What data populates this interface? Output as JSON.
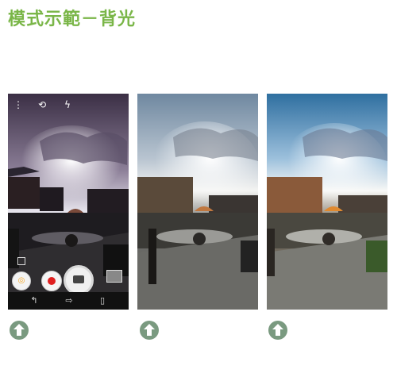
{
  "page": {
    "title": "模式示範－背光"
  },
  "panels": [
    {
      "variant": "camera-live-view",
      "tone": "dark"
    },
    {
      "variant": "photo-result",
      "tone": "neutral"
    },
    {
      "variant": "photo-result",
      "tone": "enhanced"
    }
  ],
  "camera_ui": {
    "top_icons": [
      "more-options-icon",
      "switch-camera-icon",
      "flash-icon"
    ],
    "bottom_controls": [
      "mode-icon",
      "record-video-button",
      "shutter-button",
      "gallery-thumbnail"
    ],
    "nav_icons": [
      "back-icon",
      "home-icon",
      "recents-icon"
    ]
  },
  "arrow_icon": "upload-arrow-icon",
  "colors": {
    "title": "#7ab648",
    "arrow": "#7a9a80"
  }
}
